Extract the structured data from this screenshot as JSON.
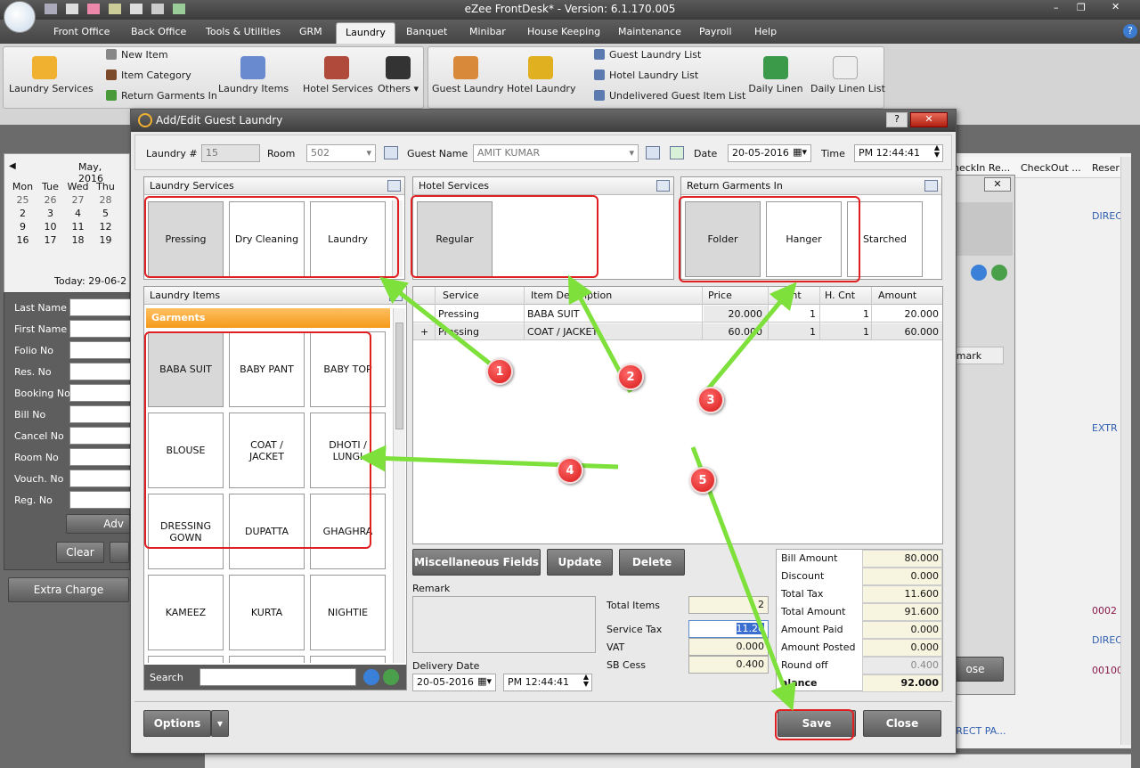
{
  "app": {
    "title": "eZee FrontDesk* - Version: 6.1.170.005"
  },
  "menu": [
    "Front Office",
    "Back Office",
    "Tools & Utilities",
    "GRM",
    "Laundry",
    "Banquet",
    "Minibar",
    "House Keeping",
    "Maintenance",
    "Payroll",
    "Help"
  ],
  "ribbon": {
    "laundry_services": "Laundry Services",
    "new_item": "New Item",
    "item_category": "Item Category",
    "return_garments": "Return Garments In",
    "laundry_items": "Laundry Items",
    "hotel_services": "Hotel Services",
    "others": "Others",
    "guest_laundry": "Guest Laundry",
    "hotel_laundry": "Hotel Laundry",
    "guest_laundry_list": "Guest Laundry List",
    "hotel_laundry_list": "Hotel Laundry List",
    "undelivered": "Undelivered Guest Item List",
    "daily_linen": "Daily Linen",
    "daily_linen_list": "Daily Linen List"
  },
  "calendar": {
    "month": "May, 2016",
    "days": [
      "Mon",
      "Tue",
      "Wed",
      "Thu"
    ],
    "rows": [
      [
        "25",
        "26",
        "27",
        "28"
      ],
      [
        "2",
        "3",
        "4",
        "5"
      ],
      [
        "9",
        "10",
        "11",
        "12"
      ],
      [
        "16",
        "17",
        "18",
        "19"
      ]
    ],
    "today": "Today: 29-06-2"
  },
  "search_fields": [
    "Last Name",
    "First Name",
    "Folio No",
    "Res. No",
    "Booking No",
    "Bill No",
    "Cancel No",
    "Room No",
    "Vouch. No",
    "Reg. No"
  ],
  "left_buttons": {
    "adv": "Adv",
    "clear": "Clear",
    "extra_charge": "Extra Charge"
  },
  "bg_right": {
    "col1": "heckIn Re...",
    "col2": "CheckOut ...",
    "col3": "Reser",
    "v1": "DIREC",
    "v2": "EXTR",
    "v3": "0002",
    "v4": "DIREC",
    "v5": "00100",
    "v6": "IRECT PA...",
    "remark": "emark",
    "close": "ose"
  },
  "dialog": {
    "title": "Add/Edit Guest Laundry",
    "laundry_no_label": "Laundry #",
    "laundry_no": "15",
    "room_label": "Room",
    "room": "502",
    "guest_label": "Guest Name",
    "guest": "AMIT KUMAR",
    "date_label": "Date",
    "date": "20-05-2016",
    "time_label": "Time",
    "time": "PM 12:44:41",
    "laundry_services": {
      "title": "Laundry Services",
      "items": [
        "Pressing",
        "Dry Cleaning",
        "Laundry"
      ]
    },
    "hotel_services": {
      "title": "Hotel Services",
      "items": [
        "Regular"
      ]
    },
    "return_garments": {
      "title": "Return Garments In",
      "items": [
        "Folder",
        "Hanger",
        "Starched"
      ]
    },
    "laundry_items": {
      "title": "Laundry Items",
      "category": "Garments",
      "items": [
        "BABA SUIT",
        "BABY PANT",
        "BABY TOP",
        "BLOUSE",
        "COAT / JACKET",
        "DHOTI / LUNGI",
        "DRESSING GOWN",
        "DUPATTA",
        "GHAGHRA",
        "KAMEEZ",
        "KURTA",
        "NIGHTIE"
      ],
      "search_label": "Search"
    },
    "grid": {
      "headers": [
        "Service",
        "Item Description",
        "Price",
        "Count",
        "H. Cnt",
        "Amount"
      ],
      "rows": [
        {
          "marker": "",
          "service": "Pressing",
          "item": "BABA SUIT",
          "price": "20.000",
          "count": "1",
          "hcnt": "1",
          "amount": "20.000"
        },
        {
          "marker": "+",
          "service": "Pressing",
          "item": "COAT / JACKET",
          "price": "60.000",
          "count": "1",
          "hcnt": "1",
          "amount": "60.000"
        }
      ]
    },
    "buttons": {
      "misc": "Miscellaneous Fields",
      "update": "Update",
      "delete": "Delete",
      "options": "Options",
      "save": "Save",
      "close": "Close"
    },
    "remark_label": "Remark",
    "delivery_label": "Delivery Date",
    "delivery_date": "20-05-2016",
    "delivery_time": "PM 12:44:41",
    "totals": {
      "total_items_label": "Total Items",
      "total_items": "2",
      "service_tax_label": "Service Tax",
      "service_tax": "11.20",
      "vat_label": "VAT",
      "vat": "0.000",
      "sb_cess_label": "SB Cess",
      "sb_cess": "0.400"
    },
    "summary": [
      {
        "k": "Bill Amount",
        "v": "80.000"
      },
      {
        "k": "Discount",
        "v": "0.000"
      },
      {
        "k": "Total Tax",
        "v": "11.600"
      },
      {
        "k": "Total Amount",
        "v": "91.600"
      },
      {
        "k": "Amount Paid",
        "v": "0.000"
      },
      {
        "k": "Amount Posted",
        "v": "0.000"
      },
      {
        "k": "Round off",
        "v": "0.400"
      },
      {
        "k": "alance",
        "v": "92.000"
      }
    ]
  },
  "annotations": [
    "1",
    "2",
    "3",
    "4",
    "5"
  ],
  "colors": {
    "accent": "#f7a93a",
    "annotation": "#e02020",
    "arrow": "#7ee03a"
  }
}
